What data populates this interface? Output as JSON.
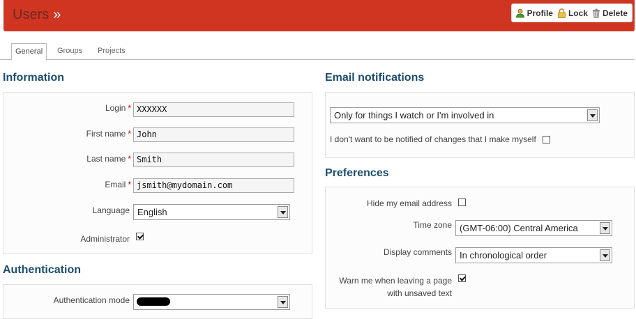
{
  "header": {
    "title": "Users",
    "separator": "»"
  },
  "actions": [
    {
      "label": "Profile",
      "icon": "user-icon"
    },
    {
      "label": "Lock",
      "icon": "lock-icon"
    },
    {
      "label": "Delete",
      "icon": "trash-icon"
    }
  ],
  "tabs": [
    {
      "label": "General",
      "active": true
    },
    {
      "label": "Groups",
      "active": false
    },
    {
      "label": "Projects",
      "active": false
    }
  ],
  "information": {
    "title": "Information",
    "login": {
      "label": "Login",
      "value": "XXXXXX",
      "required": "*"
    },
    "firstname": {
      "label": "First name",
      "value": "John",
      "required": "*"
    },
    "lastname": {
      "label": "Last name",
      "value": "Smith",
      "required": "*"
    },
    "email": {
      "label": "Email",
      "value": "jsmith@mydomain.com",
      "required": "*"
    },
    "language": {
      "label": "Language",
      "value": "English"
    },
    "administrator": {
      "label": "Administrator",
      "checked": true
    }
  },
  "authentication": {
    "title": "Authentication",
    "mode": {
      "label": "Authentication mode"
    }
  },
  "email_notifications": {
    "title": "Email notifications",
    "option": "Only for things I watch or I'm involved in",
    "no_self_notified": {
      "label": "I don't want to be notified of changes that I make myself",
      "checked": false
    }
  },
  "preferences": {
    "title": "Preferences",
    "hide_mail": {
      "label": "Hide my email address",
      "checked": false
    },
    "time_zone": {
      "label": "Time zone",
      "value": "(GMT-06:00) Central America"
    },
    "display_comments": {
      "label": "Display comments",
      "value": "In chronological order"
    },
    "warn_unsaved": {
      "label_line1": "Warn me when leaving a page",
      "label_line2": "with unsaved text",
      "checked": true
    }
  },
  "colors": {
    "header": "#d03521",
    "section_title": "#1d4d6b",
    "required": "#bb0000"
  }
}
